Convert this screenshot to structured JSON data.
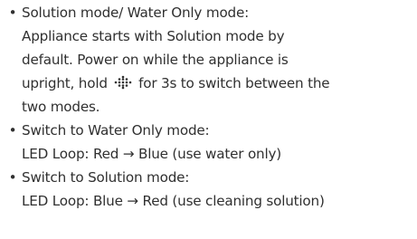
{
  "bullet_symbol": "•",
  "items": [
    {
      "lines": [
        "Solution mode/ Water Only mode:",
        "Appliance starts with Solution mode by",
        "default. Power on while the appliance is"
      ],
      "icon_line_before": "upright, hold",
      "icon_name": "dotted-mode-button-icon",
      "icon_line_after": "for 3s to switch between the",
      "last_line": "two modes."
    },
    {
      "lines": [
        "Switch to Water Only mode:",
        "LED Loop: Red → Blue (use water only)"
      ]
    },
    {
      "lines": [
        "Switch to Solution mode:",
        "LED Loop: Blue → Red (use cleaning solution)"
      ]
    }
  ]
}
